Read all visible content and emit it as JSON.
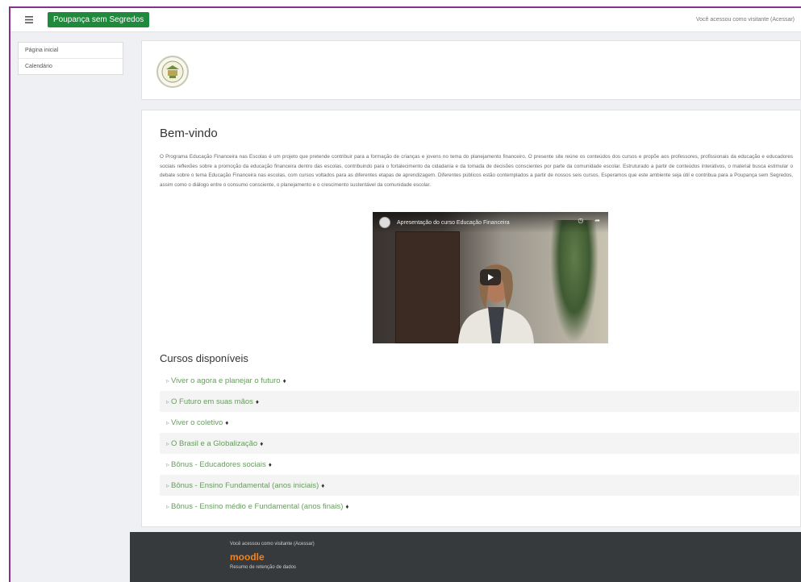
{
  "navbar": {
    "menu_icon": "hamburger-icon",
    "brand": "Poupança sem Segredos",
    "login_info": "Você acessou como visitante (Acessar)"
  },
  "drawer": {
    "items": [
      {
        "label": "Página inicial"
      },
      {
        "label": "Calendário"
      }
    ]
  },
  "main": {
    "welcome_title": "Bem-vindo",
    "intro": "O Programa Educação Financeira nas Escolas é um projeto que pretende contribuir para a formação de crianças e jovens no tema do planejamento financeiro. O presente site reúne os conteúdos dos cursos e propõe aos professores, profissionais da educação e educadores sociais reflexões sobre a promoção da educação financeira dentro das escolas, contribuindo para o fortalecimento da cidadania e da tomada de decisões conscientes por parte da comunidade escolar. Estruturado a partir de conteúdos interativos, o material busca estimular o debate sobre o tema Educação Financeira nas escolas, com cursos voltados para as diferentes etapas de aprendizagem. Diferentes públicos estão contemplados a partir de nossos seis cursos. Esperamos que este ambiente seja útil e contribua para a Poupança sem Segredos, assim como o diálogo entre o consumo consciente, o planejamento e o crescimento sustentável da comunidade escolar.",
    "video": {
      "title": "Apresentação do curso Educação Financeira",
      "actions": [
        "Assistir...",
        "Compartilhar"
      ]
    },
    "courses_title": "Cursos disponíveis",
    "courses": [
      {
        "label": "Viver o agora e planejar o futuro"
      },
      {
        "label": "O Futuro em suas mãos"
      },
      {
        "label": "Viver o coletivo"
      },
      {
        "label": "O Brasil e a Globalização"
      },
      {
        "label": "Bônus - Educadores sociais"
      },
      {
        "label": "Bônus - Ensino Fundamental (anos iniciais)"
      },
      {
        "label": "Bônus - Ensino médio e Fundamental (anos finais)"
      }
    ],
    "enrol_icon": "key-icon"
  },
  "footer": {
    "login_info": "Você acessou como visitante (Acessar)",
    "logo": "moodle",
    "data_link": "Resumo de retenção de dados"
  },
  "colors": {
    "brand": "#1f8a3c",
    "course_link": "#6a9a62",
    "footer_bg": "#373a3c",
    "frame": "#8b2f8f"
  }
}
